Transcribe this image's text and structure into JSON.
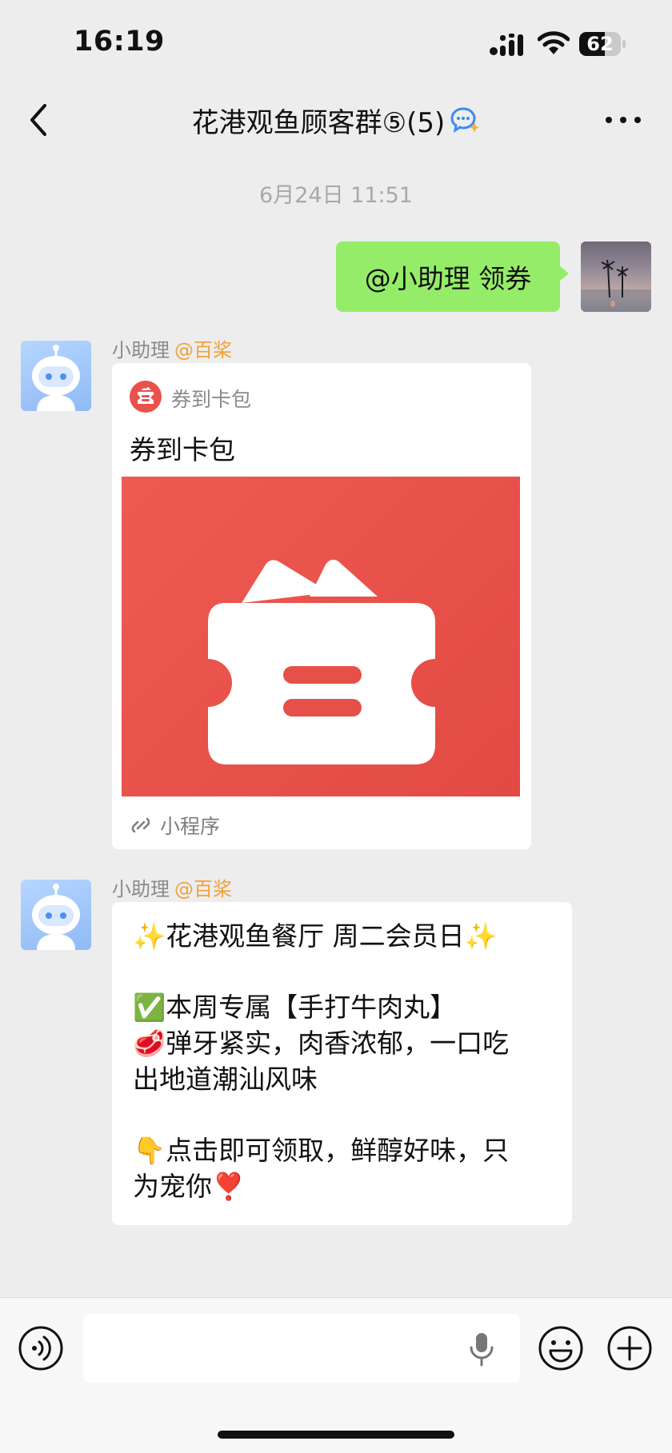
{
  "status_bar": {
    "time": "16:19",
    "battery_level": "62",
    "battery_fraction": 0.62
  },
  "nav": {
    "title": "花港观鱼顾客群⑤(5)",
    "back_icon": "chevron-left-icon",
    "more_icon": "ellipsis-icon",
    "title_icon": "chat-ai-icon"
  },
  "conversation": {
    "timestamp": "6月24日 11:51",
    "outgoing_message": "@小助理 领券",
    "card_message": {
      "sender_name": "小助理",
      "sender_tag": "@百桨",
      "app_name": "券到卡包",
      "title": "券到卡包",
      "footer_label": "小程序",
      "image_color": "#e8524a"
    },
    "text_message": {
      "sender_name": "小助理",
      "sender_tag": "@百桨",
      "lines": [
        "✨花港观鱼餐厅 周二会员日✨",
        "",
        "✅本周专属【手打牛肉丸】",
        "🥩弹牙紧实，肉香浓郁，一口吃",
        "出地道潮汕风味",
        "",
        "👇点击即可领取，鲜醇好味，只",
        "为宠你❣️"
      ]
    }
  },
  "input_bar": {
    "placeholder": "",
    "voice_icon": "voice-icon",
    "mic_icon": "microphone-icon",
    "emoji_icon": "emoji-icon",
    "plus_icon": "plus-icon"
  },
  "colors": {
    "background": "#ededed",
    "outgoing_bubble": "#95ec69",
    "sender_tag": "#f0a23a",
    "card_red": "#e8524a"
  }
}
